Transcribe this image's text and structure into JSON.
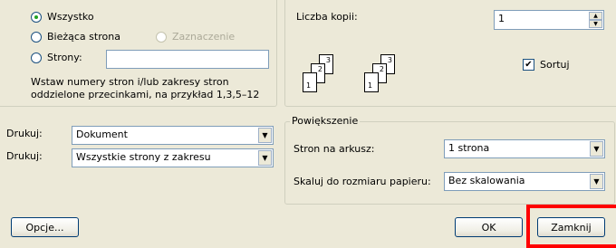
{
  "page_range": {
    "all_label": "Wszystko",
    "current_label": "Bieżąca strona",
    "selection_label": "Zaznaczenie",
    "pages_label": "Strony:",
    "pages_value": "",
    "hint_line1": "Wstaw numery stron i/lub zakresy stron",
    "hint_line2": "oddzielone przecinkami, na przykład 1,3,5–12"
  },
  "copies": {
    "label": "Liczba kopii:",
    "value": "1",
    "collate_label": "Sortuj",
    "collate_checked": true,
    "collate_glyph": "✔",
    "illustration": {
      "stack_a": [
        "3",
        "2",
        "1"
      ],
      "stack_b": [
        "3",
        "2",
        "1"
      ]
    }
  },
  "print_what": {
    "label": "Drukuj:",
    "value": "Dokument"
  },
  "print_range": {
    "label": "Drukuj:",
    "value": "Wszystkie strony z zakresu"
  },
  "zoom": {
    "legend": "Powiększenie",
    "pages_per_sheet_label": "Stron na arkusz:",
    "pages_per_sheet_value": "1 strona",
    "scale_label": "Skaluj do rozmiaru papieru:",
    "scale_value": "Bez skalowania"
  },
  "buttons": {
    "options": "Opcje...",
    "ok": "OK",
    "close": "Zamknij"
  },
  "icons": {
    "dropdown": "▼",
    "spin_up": "▲",
    "spin_down": "▼"
  },
  "colors": {
    "dialog_bg": "#ece9d8",
    "highlight_box": "#ff0000",
    "radio_dot": "#21a121"
  }
}
